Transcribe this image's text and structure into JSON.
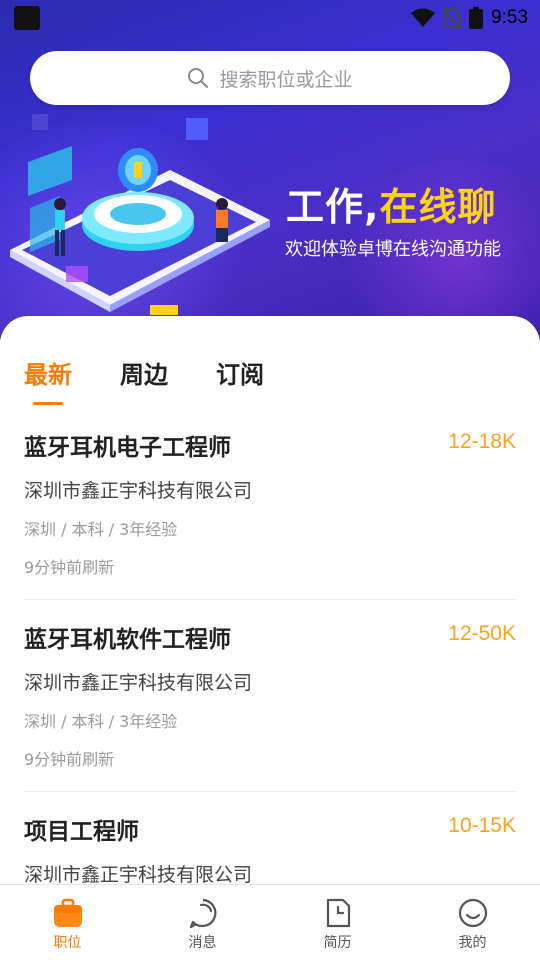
{
  "status_bar": {
    "time": "9:53"
  },
  "search": {
    "placeholder": "搜索职位或企业"
  },
  "banner": {
    "title_main": "工作,",
    "title_highlight": "在线聊",
    "subtitle": "欢迎体验卓博在线沟通功能"
  },
  "tabs": [
    {
      "label": "最新",
      "active": true
    },
    {
      "label": "周边",
      "active": false
    },
    {
      "label": "订阅",
      "active": false
    }
  ],
  "jobs": [
    {
      "title": "蓝牙耳机电子工程师",
      "salary": "12-18K",
      "company": "深圳市鑫正宇科技有限公司",
      "meta": "深圳 / 本科 / 3年经验",
      "refreshed": "9分钟前刷新"
    },
    {
      "title": "蓝牙耳机软件工程师",
      "salary": "12-50K",
      "company": "深圳市鑫正宇科技有限公司",
      "meta": "深圳 / 本科 / 3年经验",
      "refreshed": "9分钟前刷新"
    },
    {
      "title": "项目工程师",
      "salary": "10-15K",
      "company": "深圳市鑫正宇科技有限公司",
      "meta": "",
      "refreshed": ""
    }
  ],
  "bottom_nav": [
    {
      "label": "职位",
      "icon": "briefcase-icon",
      "active": true
    },
    {
      "label": "消息",
      "icon": "chat-bubble-icon",
      "active": false
    },
    {
      "label": "简历",
      "icon": "document-icon",
      "active": false
    },
    {
      "label": "我的",
      "icon": "smiley-icon",
      "active": false
    }
  ],
  "colors": {
    "accent": "#ff7a00",
    "salary": "#ffa21a",
    "banner_bg": "#3b2fd0",
    "highlight": "#ffd21a"
  }
}
